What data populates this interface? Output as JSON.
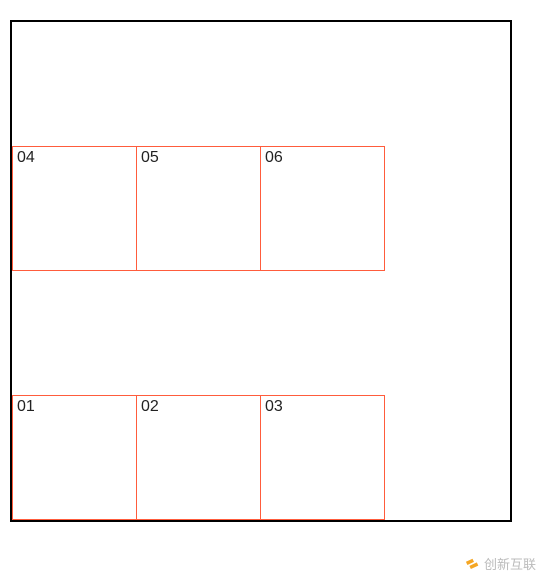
{
  "boxes": {
    "b01": "01",
    "b02": "02",
    "b03": "03",
    "b04": "04",
    "b05": "05",
    "b06": "06"
  },
  "watermark": {
    "text": "创新互联"
  }
}
